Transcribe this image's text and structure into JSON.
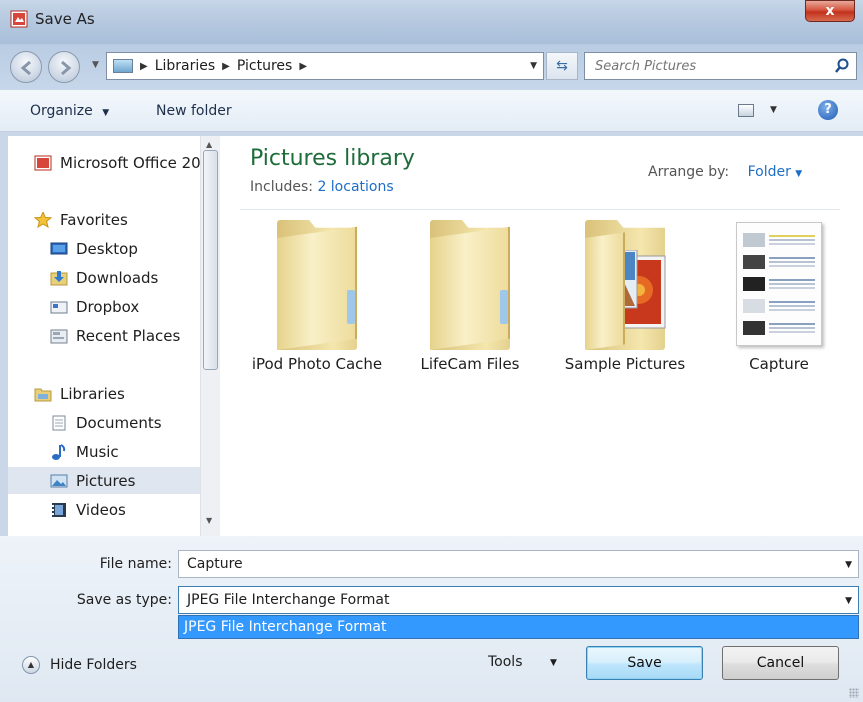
{
  "window": {
    "title": "Save As",
    "close_label": "x"
  },
  "nav": {
    "breadcrumbs": [
      "Libraries",
      "Pictures"
    ],
    "search_placeholder": "Search Pictures"
  },
  "toolbar": {
    "organize": "Organize",
    "new_folder": "New folder",
    "help": "?"
  },
  "sidebar": {
    "items": [
      {
        "label": "Microsoft Office 20",
        "icon": "office-icon"
      },
      {
        "label": "Favorites",
        "icon": "star-icon"
      },
      {
        "label": "Desktop",
        "icon": "desktop-icon"
      },
      {
        "label": "Downloads",
        "icon": "downloads-icon"
      },
      {
        "label": "Dropbox",
        "icon": "dropbox-icon"
      },
      {
        "label": "Recent Places",
        "icon": "recent-places-icon"
      },
      {
        "label": "Libraries",
        "icon": "libraries-icon"
      },
      {
        "label": "Documents",
        "icon": "documents-icon"
      },
      {
        "label": "Music",
        "icon": "music-icon"
      },
      {
        "label": "Pictures",
        "icon": "pictures-icon",
        "selected": true
      },
      {
        "label": "Videos",
        "icon": "videos-icon"
      }
    ]
  },
  "library": {
    "title": "Pictures library",
    "includes_label": "Includes:",
    "includes_link": "2 locations",
    "arrange_label": "Arrange by:",
    "arrange_value": "Folder"
  },
  "items": [
    {
      "name": "iPod Photo Cache",
      "type": "folder"
    },
    {
      "name": "LifeCam Files",
      "type": "folder"
    },
    {
      "name": "Sample Pictures",
      "type": "folder-with-photo"
    },
    {
      "name": "Capture",
      "type": "image"
    }
  ],
  "form": {
    "file_name_label": "File name:",
    "file_name_value": "Capture",
    "save_type_label": "Save as type:",
    "save_type_value": "JPEG File Interchange Format",
    "dropdown_options": [
      "JPEG File Interchange Format"
    ]
  },
  "footer": {
    "hide_folders": "Hide Folders",
    "tools": "Tools",
    "save": "Save",
    "cancel": "Cancel"
  },
  "colors": {
    "library_title": "#1e6c3a",
    "link": "#1f6ec6",
    "selection": "#3399ff",
    "close_button": "#c2311c"
  }
}
